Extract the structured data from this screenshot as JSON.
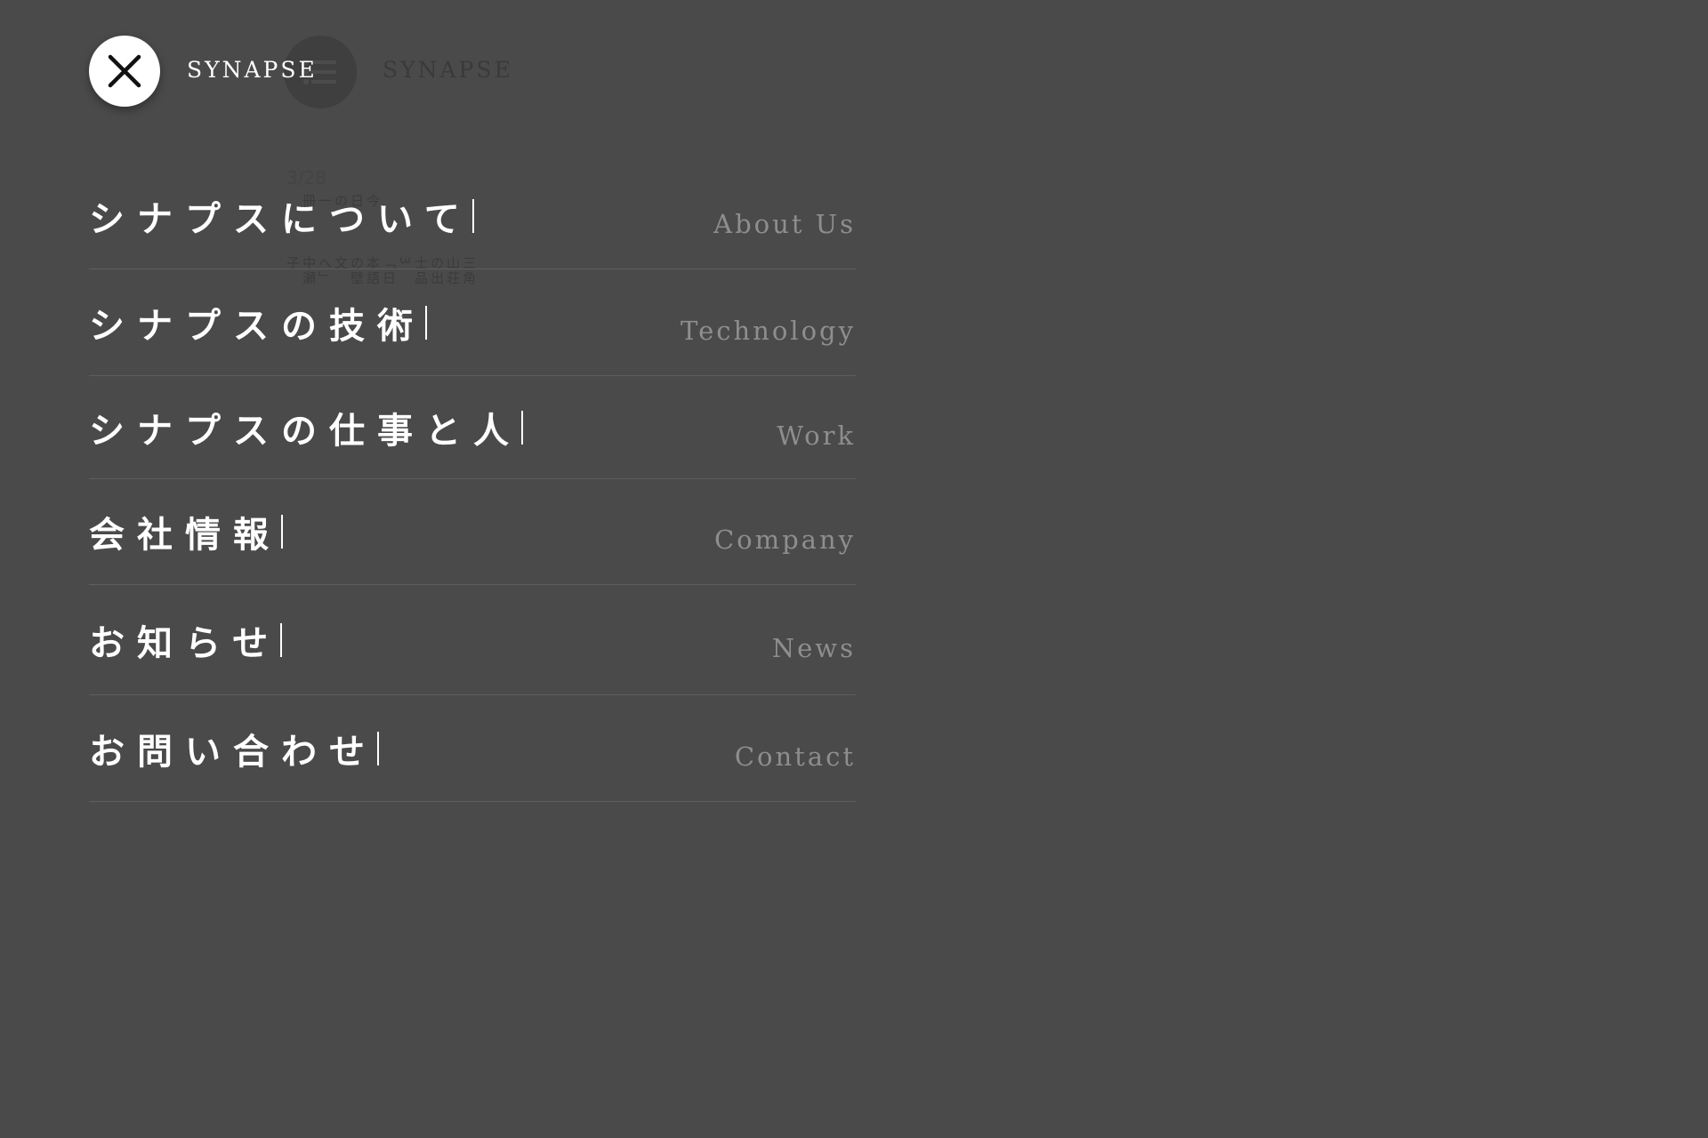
{
  "background_page": {
    "menu_icon": "list-icon",
    "logo": "SYNAPSE",
    "date": "3/28",
    "vertical_text_1": "今日の一冊",
    "vertical_text_2": "三角山荘の出士品 3「日本語の壁文へ」中瀬子"
  },
  "header": {
    "close_icon": "close-icon",
    "logo": "SYNAPSE"
  },
  "nav": {
    "items": [
      {
        "jp": "シナプスについて",
        "en": "About Us"
      },
      {
        "jp": "シナプスの技術",
        "en": "Technology"
      },
      {
        "jp": "シナプスの仕事と人",
        "en": "Work"
      },
      {
        "jp": "会社情報",
        "en": "Company"
      },
      {
        "jp": "お知らせ",
        "en": "News"
      },
      {
        "jp": "お問い合わせ",
        "en": "Contact"
      }
    ]
  },
  "colors": {
    "overlay_background": "#4a4a4a",
    "primary_text": "#ffffff",
    "secondary_text": "#8e8e8e",
    "divider": "#5e5e5e"
  }
}
